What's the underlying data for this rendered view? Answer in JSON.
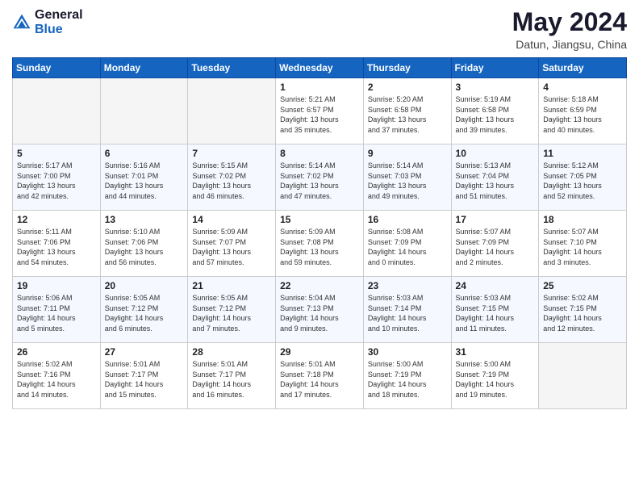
{
  "header": {
    "logo_line1": "General",
    "logo_line2": "Blue",
    "month": "May 2024",
    "location": "Datun, Jiangsu, China"
  },
  "weekdays": [
    "Sunday",
    "Monday",
    "Tuesday",
    "Wednesday",
    "Thursday",
    "Friday",
    "Saturday"
  ],
  "weeks": [
    [
      {
        "day": "",
        "info": ""
      },
      {
        "day": "",
        "info": ""
      },
      {
        "day": "",
        "info": ""
      },
      {
        "day": "1",
        "info": "Sunrise: 5:21 AM\nSunset: 6:57 PM\nDaylight: 13 hours\nand 35 minutes."
      },
      {
        "day": "2",
        "info": "Sunrise: 5:20 AM\nSunset: 6:58 PM\nDaylight: 13 hours\nand 37 minutes."
      },
      {
        "day": "3",
        "info": "Sunrise: 5:19 AM\nSunset: 6:58 PM\nDaylight: 13 hours\nand 39 minutes."
      },
      {
        "day": "4",
        "info": "Sunrise: 5:18 AM\nSunset: 6:59 PM\nDaylight: 13 hours\nand 40 minutes."
      }
    ],
    [
      {
        "day": "5",
        "info": "Sunrise: 5:17 AM\nSunset: 7:00 PM\nDaylight: 13 hours\nand 42 minutes."
      },
      {
        "day": "6",
        "info": "Sunrise: 5:16 AM\nSunset: 7:01 PM\nDaylight: 13 hours\nand 44 minutes."
      },
      {
        "day": "7",
        "info": "Sunrise: 5:15 AM\nSunset: 7:02 PM\nDaylight: 13 hours\nand 46 minutes."
      },
      {
        "day": "8",
        "info": "Sunrise: 5:14 AM\nSunset: 7:02 PM\nDaylight: 13 hours\nand 47 minutes."
      },
      {
        "day": "9",
        "info": "Sunrise: 5:14 AM\nSunset: 7:03 PM\nDaylight: 13 hours\nand 49 minutes."
      },
      {
        "day": "10",
        "info": "Sunrise: 5:13 AM\nSunset: 7:04 PM\nDaylight: 13 hours\nand 51 minutes."
      },
      {
        "day": "11",
        "info": "Sunrise: 5:12 AM\nSunset: 7:05 PM\nDaylight: 13 hours\nand 52 minutes."
      }
    ],
    [
      {
        "day": "12",
        "info": "Sunrise: 5:11 AM\nSunset: 7:06 PM\nDaylight: 13 hours\nand 54 minutes."
      },
      {
        "day": "13",
        "info": "Sunrise: 5:10 AM\nSunset: 7:06 PM\nDaylight: 13 hours\nand 56 minutes."
      },
      {
        "day": "14",
        "info": "Sunrise: 5:09 AM\nSunset: 7:07 PM\nDaylight: 13 hours\nand 57 minutes."
      },
      {
        "day": "15",
        "info": "Sunrise: 5:09 AM\nSunset: 7:08 PM\nDaylight: 13 hours\nand 59 minutes."
      },
      {
        "day": "16",
        "info": "Sunrise: 5:08 AM\nSunset: 7:09 PM\nDaylight: 14 hours\nand 0 minutes."
      },
      {
        "day": "17",
        "info": "Sunrise: 5:07 AM\nSunset: 7:09 PM\nDaylight: 14 hours\nand 2 minutes."
      },
      {
        "day": "18",
        "info": "Sunrise: 5:07 AM\nSunset: 7:10 PM\nDaylight: 14 hours\nand 3 minutes."
      }
    ],
    [
      {
        "day": "19",
        "info": "Sunrise: 5:06 AM\nSunset: 7:11 PM\nDaylight: 14 hours\nand 5 minutes."
      },
      {
        "day": "20",
        "info": "Sunrise: 5:05 AM\nSunset: 7:12 PM\nDaylight: 14 hours\nand 6 minutes."
      },
      {
        "day": "21",
        "info": "Sunrise: 5:05 AM\nSunset: 7:12 PM\nDaylight: 14 hours\nand 7 minutes."
      },
      {
        "day": "22",
        "info": "Sunrise: 5:04 AM\nSunset: 7:13 PM\nDaylight: 14 hours\nand 9 minutes."
      },
      {
        "day": "23",
        "info": "Sunrise: 5:03 AM\nSunset: 7:14 PM\nDaylight: 14 hours\nand 10 minutes."
      },
      {
        "day": "24",
        "info": "Sunrise: 5:03 AM\nSunset: 7:15 PM\nDaylight: 14 hours\nand 11 minutes."
      },
      {
        "day": "25",
        "info": "Sunrise: 5:02 AM\nSunset: 7:15 PM\nDaylight: 14 hours\nand 12 minutes."
      }
    ],
    [
      {
        "day": "26",
        "info": "Sunrise: 5:02 AM\nSunset: 7:16 PM\nDaylight: 14 hours\nand 14 minutes."
      },
      {
        "day": "27",
        "info": "Sunrise: 5:01 AM\nSunset: 7:17 PM\nDaylight: 14 hours\nand 15 minutes."
      },
      {
        "day": "28",
        "info": "Sunrise: 5:01 AM\nSunset: 7:17 PM\nDaylight: 14 hours\nand 16 minutes."
      },
      {
        "day": "29",
        "info": "Sunrise: 5:01 AM\nSunset: 7:18 PM\nDaylight: 14 hours\nand 17 minutes."
      },
      {
        "day": "30",
        "info": "Sunrise: 5:00 AM\nSunset: 7:19 PM\nDaylight: 14 hours\nand 18 minutes."
      },
      {
        "day": "31",
        "info": "Sunrise: 5:00 AM\nSunset: 7:19 PM\nDaylight: 14 hours\nand 19 minutes."
      },
      {
        "day": "",
        "info": ""
      }
    ]
  ]
}
